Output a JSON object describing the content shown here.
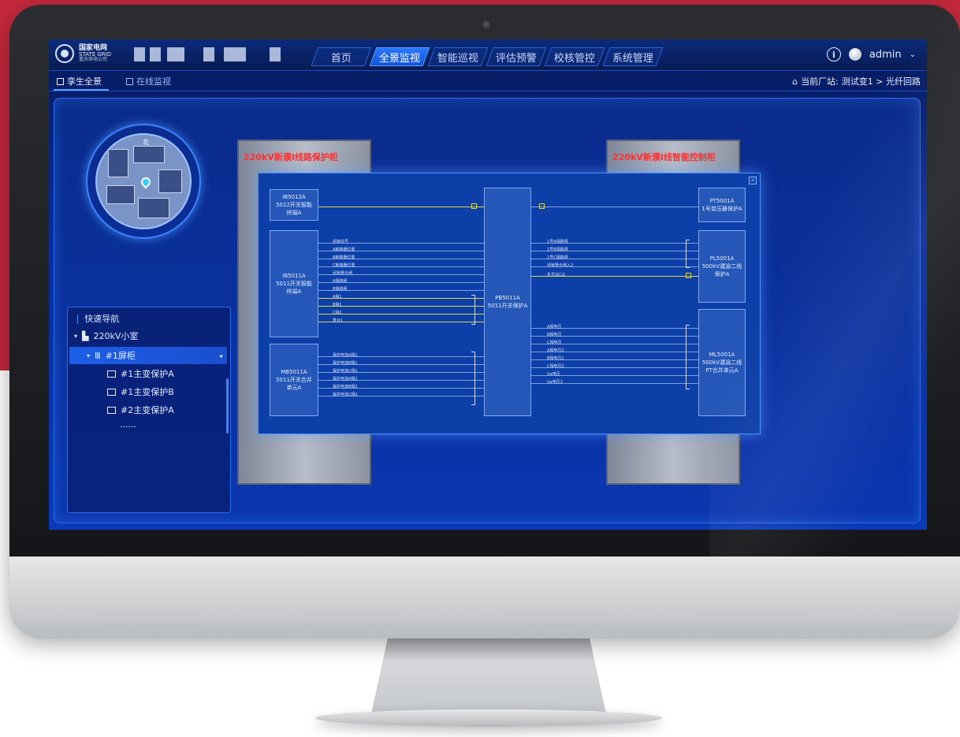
{
  "logo": {
    "line1": "国家电网",
    "line2": "STATE GRID",
    "line3": "重庆供电公司"
  },
  "nav": {
    "items": [
      {
        "label": "首页",
        "active": false
      },
      {
        "label": "全景监视",
        "active": true
      },
      {
        "label": "智能巡视",
        "active": false
      },
      {
        "label": "评估预警",
        "active": false
      },
      {
        "label": "校核管控",
        "active": false
      },
      {
        "label": "系统管理",
        "active": false
      }
    ]
  },
  "user": {
    "name": "admin",
    "caret": "⌄",
    "info_icon": "i"
  },
  "subnav": {
    "tabs": [
      {
        "label": "孪生全景",
        "icon": "list-icon",
        "active": true
      },
      {
        "label": "在线监视",
        "icon": "calendar-icon",
        "active": false
      }
    ]
  },
  "breadcrumb": {
    "prefix": "当前厂站:",
    "path": "测试变1 > 光纤回路"
  },
  "minimap": {
    "label": "北"
  },
  "quick_nav": {
    "title": "快速导航",
    "tree": [
      {
        "label": "220kV小室",
        "level": 0,
        "expanded": true
      },
      {
        "label": "#1屏柜",
        "level": 1,
        "expanded": true,
        "selected": true
      },
      {
        "label": "#1主变保护A",
        "level": 2
      },
      {
        "label": "#1主变保护B",
        "level": 2
      },
      {
        "label": "#2主变保护A",
        "level": 2
      },
      {
        "label": "......",
        "level": 2
      }
    ]
  },
  "cabinets": {
    "left_title": "220kV新濮I线路保护柜",
    "right_title": "220kV新濮I线智能控制柜"
  },
  "diagram": {
    "close": "×",
    "devices": {
      "ib5012a": "IB5012A\n5012开关智能\n终端A",
      "ib5011a": "IB5011A\n5011开关智能\n终端A",
      "mb5011a": "MB5011A\n5011开关合并\n单元A",
      "pb5011a": "PB5011A\n5011开关保护A",
      "pt5001a": "PT5001A\n1号变压器保护A",
      "pl5001a": "PL5001A\n500kV濮渝二线\n保护A",
      "ml5001a": "ML5001A\n500kV濮渝二线\nPT合并单元A"
    },
    "signals_left_top": [
      "闭锁信号",
      "A断路器位置",
      "B断路器位置",
      "C断路器位置",
      "闭锁重合闸",
      "A相跳闸",
      "B相跳闸",
      "C相跳闸"
    ],
    "signals_left_mid": [
      "A相1",
      "B相1",
      "C相1",
      "重合1"
    ],
    "signals_left_bottom": [
      "保护电流A相1",
      "保护电流B相1",
      "保护电流C相1",
      "保护电流A相2",
      "保护电流B相2",
      "保护电流C相2"
    ],
    "signals_right_top": [
      "1号A相跳闸",
      "1号B相跳闸",
      "1号C相跳闸",
      "闭锁重合闸入2",
      "失灵出口2"
    ],
    "signals_right_bottom": [
      "A相电压",
      "B相电压",
      "C相电压",
      "A相电压2",
      "B相电压2",
      "C相电压2",
      "Ua电压",
      "Ua电压2"
    ]
  }
}
